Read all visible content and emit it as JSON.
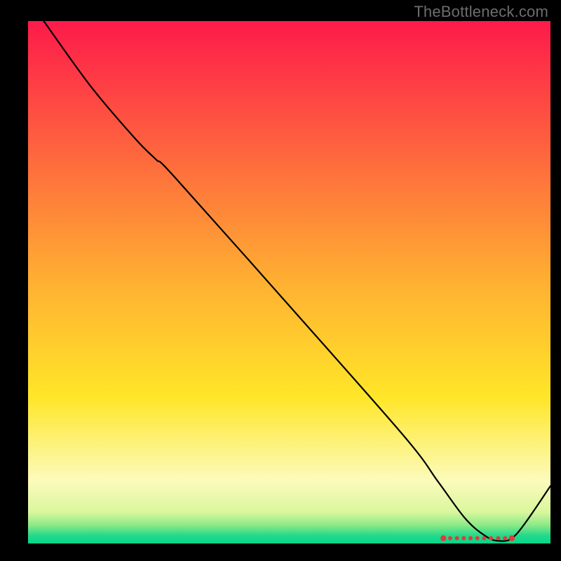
{
  "watermark": "TheBottleneck.com",
  "chart_data": {
    "type": "line",
    "title": "",
    "xlabel": "",
    "ylabel": "",
    "xlim": [
      0,
      1
    ],
    "ylim": [
      0,
      1
    ],
    "grid": false,
    "legend": false,
    "gradient_stops": [
      {
        "offset": 0.0,
        "color": "#fd1a4a"
      },
      {
        "offset": 0.5,
        "color": "#ffb032"
      },
      {
        "offset": 0.72,
        "color": "#ffe628"
      },
      {
        "offset": 0.88,
        "color": "#fcfbbc"
      },
      {
        "offset": 0.94,
        "color": "#d9f79d"
      },
      {
        "offset": 0.965,
        "color": "#8be987"
      },
      {
        "offset": 0.985,
        "color": "#22d98a"
      },
      {
        "offset": 1.0,
        "color": "#05d68b"
      }
    ],
    "series": [
      {
        "name": "bottleneck-curve",
        "stroke": "#000000",
        "fill": "none",
        "x": [
          0.03,
          0.12,
          0.205,
          0.245,
          0.28,
          0.5,
          0.72,
          0.785,
          0.835,
          0.87,
          0.9,
          0.935,
          1.0
        ],
        "y": [
          1.0,
          0.875,
          0.775,
          0.735,
          0.702,
          0.455,
          0.205,
          0.118,
          0.05,
          0.018,
          0.005,
          0.018,
          0.11
        ]
      },
      {
        "name": "optimal-band-dots",
        "type": "scatter",
        "stroke": "#e03b3b",
        "fill": "#e03b3b",
        "x": [
          0.795,
          0.808,
          0.821,
          0.834,
          0.847,
          0.86,
          0.873,
          0.886,
          0.9,
          0.913,
          0.926
        ],
        "y": [
          0.01,
          0.01,
          0.01,
          0.01,
          0.01,
          0.01,
          0.01,
          0.01,
          0.01,
          0.01,
          0.01
        ]
      }
    ]
  }
}
